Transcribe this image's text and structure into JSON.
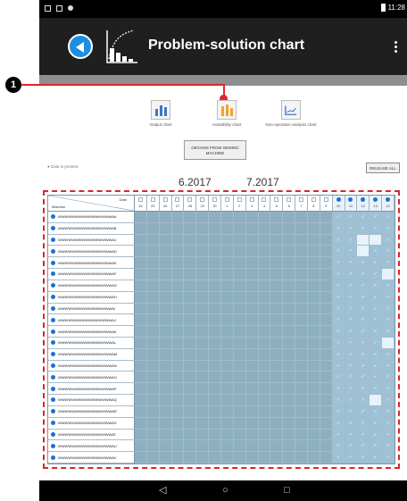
{
  "status_bar": {
    "time": "11:28"
  },
  "app_bar": {
    "title": "Problem-solution chart"
  },
  "callout": {
    "number": "1"
  },
  "chart_buttons": [
    {
      "label": "Output chart",
      "icon": "bar-chart-icon"
    },
    {
      "label": "Availability chart",
      "icon": "availability-chart-icon"
    },
    {
      "label": "Non-operation analysis chart",
      "icon": "line-chart-icon"
    }
  ],
  "obtain_button": {
    "label": "OBTAINS FROM SEWING MACHINE"
  },
  "data_present": {
    "label": "● Data is present"
  },
  "release_all": {
    "label": "RELEASE ALL"
  },
  "months": [
    "6.2017",
    "7.2017"
  ],
  "grid": {
    "header_date_label": "Date",
    "header_machine_label": "Machine",
    "days": [
      "24",
      "25",
      "26",
      "27",
      "28",
      "29",
      "30",
      "1",
      "2",
      "3",
      "4",
      "5",
      "6",
      "7",
      "8",
      "9",
      "10",
      "11",
      "12",
      "13",
      "14"
    ],
    "active_days": [
      "10",
      "11",
      "12",
      "13",
      "14"
    ],
    "rows": [
      "WWWWWWWWWWWWWWWWAA",
      "WWWWWWWWWWWWWWWWAB",
      "WWWWWWWWWWWWWWWWAC",
      "WWWWWWWWWWWWWWWWAD",
      "WWWWWWWWWWWWWWWWAE",
      "WWWWWWWWWWWWWWWWAF",
      "WWWWWWWWWWWWWWWWAG",
      "WWWWWWWWWWWWWWWWAH",
      "WWWWWWWWWWWWWWWWAI",
      "WWWWWWWWWWWWWWWWAJ",
      "WWWWWWWWWWWWWWWWAK",
      "WWWWWWWWWWWWWWWWAL",
      "WWWWWWWWWWWWWWWWAM",
      "WWWWWWWWWWWWWWWWAN",
      "WWWWWWWWWWWWWWWWAO",
      "WWWWWWWWWWWWWWWWAP",
      "WWWWWWWWWWWWWWWWAQ",
      "WWWWWWWWWWWWWWWWAR",
      "WWWWWWWWWWWWWWWWAS",
      "WWWWWWWWWWWWWWWWAT",
      "WWWWWWWWWWWWWWWWAU",
      "WWWWWWWWWWWWWWWWAV"
    ]
  },
  "nav_bar": {
    "back": "◁",
    "home": "○",
    "recents": "□"
  },
  "colors": {
    "accent": "#1e8fe0",
    "callout": "#e0262f",
    "grid_cell": "#8eafbf"
  }
}
